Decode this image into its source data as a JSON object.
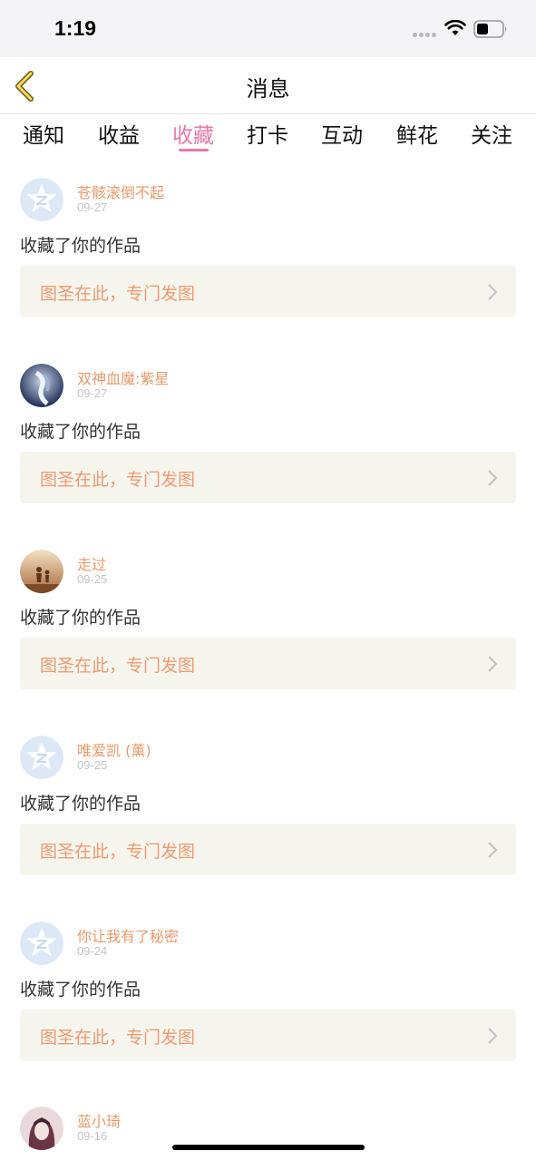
{
  "status_bar": {
    "time": "1:19"
  },
  "header": {
    "title": "消息"
  },
  "tabs": [
    {
      "label": "通知",
      "active": false
    },
    {
      "label": "收益",
      "active": false
    },
    {
      "label": "收藏",
      "active": true
    },
    {
      "label": "打卡",
      "active": false
    },
    {
      "label": "互动",
      "active": false
    },
    {
      "label": "鲜花",
      "active": false
    },
    {
      "label": "关注",
      "active": false
    }
  ],
  "messages": [
    {
      "user": "苍骸滚倒不起",
      "date": "09-27",
      "action": "收藏了你的作品",
      "work": "图圣在此，专门发图",
      "avatar": "default-avatar-icon"
    },
    {
      "user": "双神血魔:紫星",
      "date": "09-27",
      "action": "收藏了你的作品",
      "work": "图圣在此，专门发图",
      "avatar": "user-avatar-anime"
    },
    {
      "user": "走过",
      "date": "09-25",
      "action": "收藏了你的作品",
      "work": "图圣在此，专门发图",
      "avatar": "user-avatar-sunset"
    },
    {
      "user": "唯爱凯 (薰)",
      "date": "09-25",
      "action": "收藏了你的作品",
      "work": "图圣在此，专门发图",
      "avatar": "default-avatar-icon"
    },
    {
      "user": "你让我有了秘密",
      "date": "09-24",
      "action": "收藏了你的作品",
      "work": "图圣在此，专门发图",
      "avatar": "default-avatar-icon"
    },
    {
      "user": "蓝小琦",
      "date": "09-16",
      "action": "",
      "work": "",
      "avatar": "user-avatar-girl"
    }
  ],
  "colors": {
    "accent": "#e878a8",
    "username": "#e89a6a",
    "work_title": "#ef9a70"
  }
}
